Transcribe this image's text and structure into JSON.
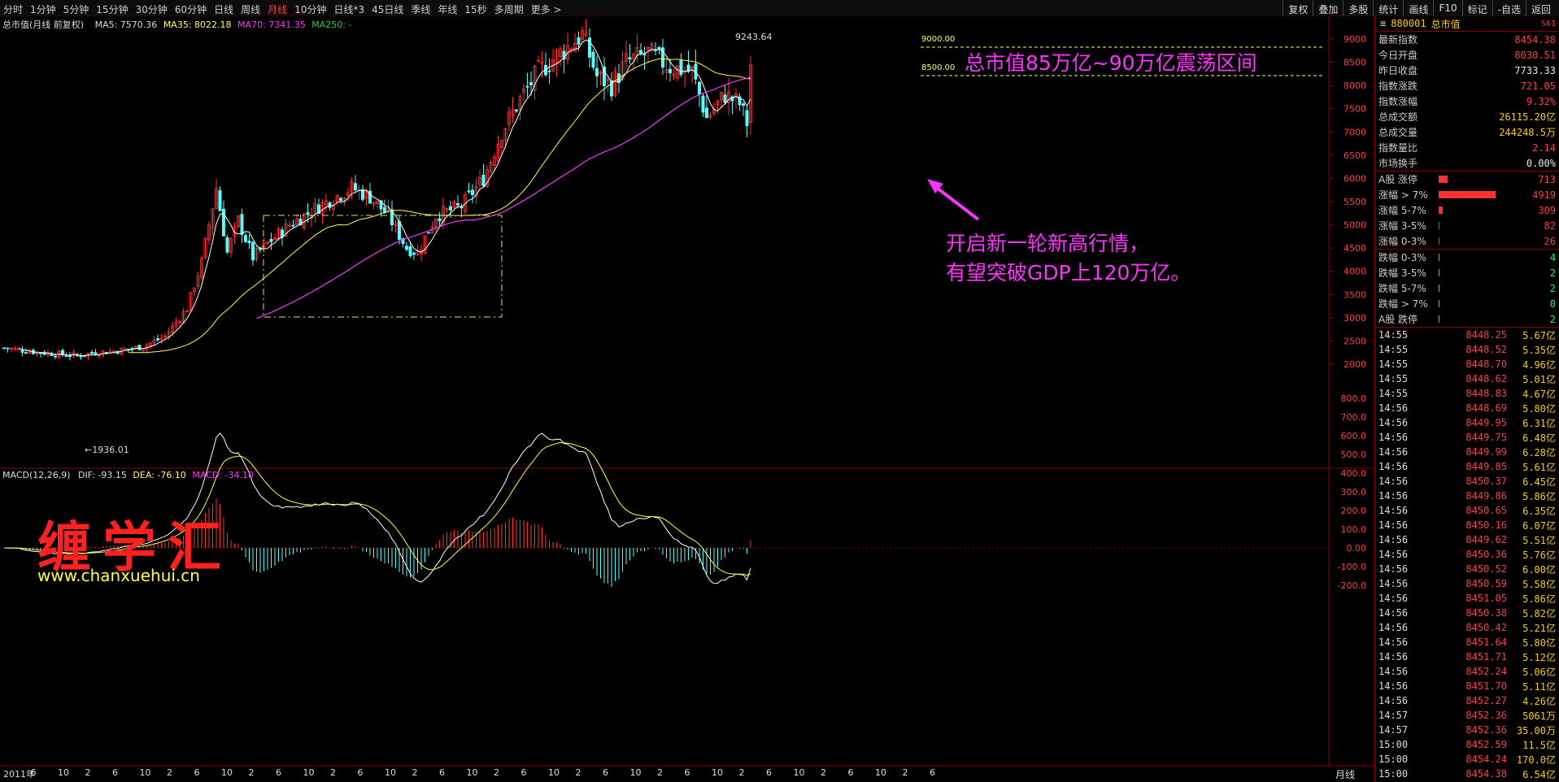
{
  "toolbar": {
    "periods": [
      "分时",
      "1分钟",
      "5分钟",
      "15分钟",
      "30分钟",
      "60分钟",
      "日线",
      "周线",
      "月线",
      "10分钟",
      "日线*3",
      "45日线",
      "季线",
      "年线",
      "15秒",
      "多周期",
      "更多 >"
    ],
    "active_period": "月线",
    "right_buttons": [
      "复权",
      "叠加",
      "多股",
      "统计",
      "画线",
      "F10",
      "标记",
      "-自选",
      "返回"
    ]
  },
  "main_chart": {
    "title": "总市值(月线 前复权)",
    "ma5": "MA5: 7570.36",
    "ma35": "MA35: 8022.18",
    "ma70": "MA70: 7341.35",
    "ma250": "MA250: -",
    "high_label": "9243.64",
    "low_label": "←1936.01",
    "line_9000": "9000.00",
    "line_8500": "8500.00",
    "annotation_top": "总市值85万亿~90万亿震荡区间",
    "annotation_line1": "开启新一轮新高行情，",
    "annotation_line2": "有望突破GDP上120万亿。",
    "y_ticks": [
      "9000",
      "8500",
      "8000",
      "7500",
      "7000",
      "6500",
      "6000",
      "5500",
      "5000",
      "4500",
      "4000",
      "3500",
      "3000",
      "2500",
      "2000"
    ]
  },
  "macd_chart": {
    "title": "MACD(12,26,9)",
    "dif": "DIF: -93.15",
    "dea": "DEA: -76.10",
    "macd": "MACD: -34.10",
    "y_ticks": [
      "800.0",
      "700.0",
      "600.0",
      "500.0",
      "400.0",
      "300.0",
      "200.0",
      "100.0",
      "0.00",
      "-100.0",
      "-200.0"
    ]
  },
  "watermark": {
    "name": "缠学汇",
    "url": "www.chanxuehui.cn"
  },
  "x_axis": {
    "labels": [
      "2011年",
      "6",
      "10",
      "2",
      "6",
      "10",
      "2",
      "6",
      "10",
      "2",
      "6",
      "10",
      "2",
      "6",
      "10",
      "2",
      "6",
      "10",
      "2",
      "6",
      "10",
      "2",
      "6",
      "10",
      "2",
      "6",
      "10",
      "2",
      "6",
      "10",
      "2",
      "6",
      "10",
      "2",
      "6"
    ],
    "period_label": "月线"
  },
  "side": {
    "code": "880001",
    "name": "总市值",
    "tag": "S61",
    "stats": [
      {
        "k": "最新指数",
        "v": "8454.38",
        "c": "red"
      },
      {
        "k": "今日开盘",
        "v": "8030.51",
        "c": "red"
      },
      {
        "k": "昨日收盘",
        "v": "7733.33",
        "c": "wht"
      },
      {
        "k": "指数涨跌",
        "v": "721.05",
        "c": "red"
      },
      {
        "k": "指数涨幅",
        "v": "9.32%",
        "c": "red"
      },
      {
        "k": "总成交额",
        "v": "26115.20亿",
        "c": "yel"
      },
      {
        "k": "总成交量",
        "v": "244248.5万",
        "c": "yel"
      },
      {
        "k": "指数量比",
        "v": "2.14",
        "c": "red"
      },
      {
        "k": "市场换手",
        "v": "0.00%",
        "c": "wht"
      }
    ],
    "up": [
      {
        "k": "A股 涨停",
        "v": "713",
        "bar": 0.16
      },
      {
        "k": "涨幅 > 7%",
        "v": "4919",
        "bar": 1.0
      },
      {
        "k": "涨幅 5-7%",
        "v": "309",
        "bar": 0.07
      },
      {
        "k": "涨幅 3-5%",
        "v": "82",
        "bar": 0.02
      },
      {
        "k": "涨幅 0-3%",
        "v": "26",
        "bar": 0.01
      }
    ],
    "down": [
      {
        "k": "跌幅 0-3%",
        "v": "4"
      },
      {
        "k": "跌幅 3-5%",
        "v": "2"
      },
      {
        "k": "跌幅 5-7%",
        "v": "2"
      },
      {
        "k": "跌幅 > 7%",
        "v": "0"
      },
      {
        "k": "A股 跌停",
        "v": "2"
      }
    ],
    "ticks": [
      {
        "t": "14:55",
        "p": "8448.25",
        "a": "5.67亿"
      },
      {
        "t": "14:55",
        "p": "8448.52",
        "a": "5.35亿"
      },
      {
        "t": "14:55",
        "p": "8448.70",
        "a": "4.96亿"
      },
      {
        "t": "14:55",
        "p": "8448.62",
        "a": "5.01亿"
      },
      {
        "t": "14:55",
        "p": "8448.83",
        "a": "4.67亿"
      },
      {
        "t": "14:56",
        "p": "8448.69",
        "a": "5.80亿"
      },
      {
        "t": "14:56",
        "p": "8449.95",
        "a": "6.31亿"
      },
      {
        "t": "14:56",
        "p": "8449.75",
        "a": "6.48亿"
      },
      {
        "t": "14:56",
        "p": "8449.99",
        "a": "6.28亿"
      },
      {
        "t": "14:56",
        "p": "8449.85",
        "a": "5.61亿"
      },
      {
        "t": "14:56",
        "p": "8450.37",
        "a": "6.45亿"
      },
      {
        "t": "14:56",
        "p": "8449.86",
        "a": "5.86亿"
      },
      {
        "t": "14:56",
        "p": "8450.65",
        "a": "6.35亿"
      },
      {
        "t": "14:56",
        "p": "8450.16",
        "a": "6.07亿"
      },
      {
        "t": "14:56",
        "p": "8449.62",
        "a": "5.51亿"
      },
      {
        "t": "14:56",
        "p": "8450.36",
        "a": "5.76亿"
      },
      {
        "t": "14:56",
        "p": "8450.52",
        "a": "6.00亿"
      },
      {
        "t": "14:56",
        "p": "8450.59",
        "a": "5.58亿"
      },
      {
        "t": "14:56",
        "p": "8451.05",
        "a": "5.86亿"
      },
      {
        "t": "14:56",
        "p": "8450.38",
        "a": "5.82亿"
      },
      {
        "t": "14:56",
        "p": "8450.42",
        "a": "5.21亿"
      },
      {
        "t": "14:56",
        "p": "8451.64",
        "a": "5.80亿"
      },
      {
        "t": "14:56",
        "p": "8451.71",
        "a": "5.12亿"
      },
      {
        "t": "14:56",
        "p": "8452.24",
        "a": "5.06亿"
      },
      {
        "t": "14:56",
        "p": "8451.70",
        "a": "5.11亿"
      },
      {
        "t": "14:56",
        "p": "8452.27",
        "a": "4.26亿"
      },
      {
        "t": "14:57",
        "p": "8452.36",
        "a": "5061万"
      },
      {
        "t": "14:57",
        "p": "8452.36",
        "a": "35.00万"
      },
      {
        "t": "15:00",
        "p": "8452.59",
        "a": "11.5亿"
      },
      {
        "t": "15:00",
        "p": "8454.24",
        "a": "170.0亿"
      },
      {
        "t": "15:00",
        "p": "8454.38",
        "a": "6.54亿"
      }
    ]
  }
}
